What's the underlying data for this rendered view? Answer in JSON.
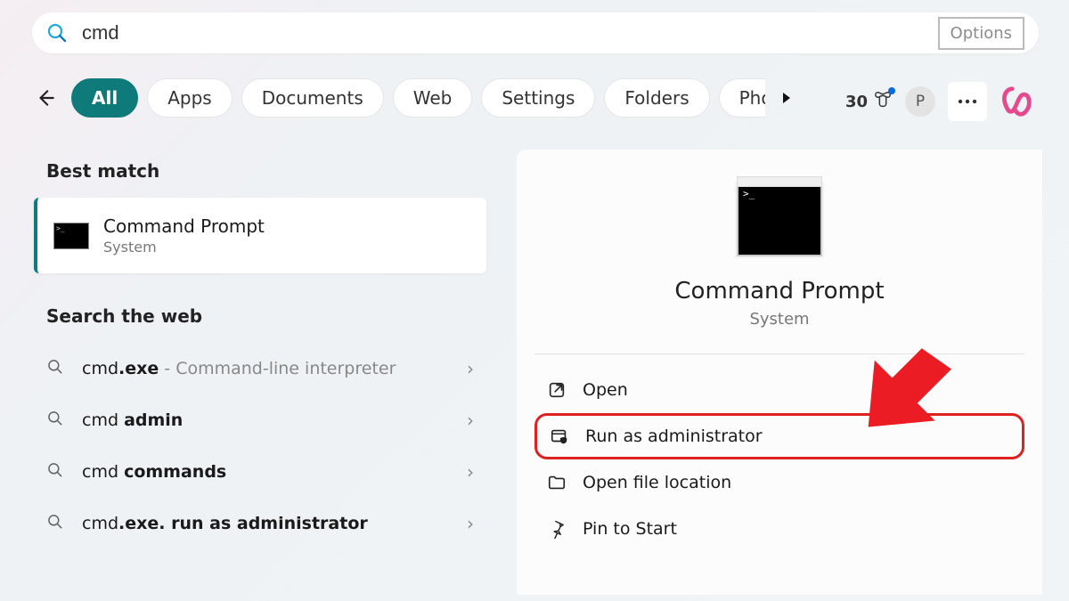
{
  "search": {
    "query": "cmd",
    "options_label": "Options"
  },
  "filters": {
    "items": [
      "All",
      "Apps",
      "Documents",
      "Web",
      "Settings",
      "Folders",
      "Pho"
    ],
    "active_index": 0
  },
  "header": {
    "points": "30",
    "avatar_initial": "P"
  },
  "left": {
    "best_match_heading": "Best match",
    "best_match": {
      "title": "Command Prompt",
      "subtitle": "System"
    },
    "web_heading": "Search the web",
    "web_items": [
      {
        "prefix": "cmd",
        "bold": ".exe",
        "suffix": " - Command-line interpreter",
        "suffix_light": true
      },
      {
        "prefix": "cmd ",
        "bold": "admin",
        "suffix": ""
      },
      {
        "prefix": "cmd ",
        "bold": "commands",
        "suffix": ""
      },
      {
        "prefix": "cmd",
        "bold": ".exe. run as administrator",
        "suffix": ""
      }
    ]
  },
  "panel": {
    "title": "Command Prompt",
    "subtitle": "System",
    "actions": [
      {
        "icon": "open-external",
        "label": "Open"
      },
      {
        "icon": "shield-window",
        "label": "Run as administrator",
        "highlight": true
      },
      {
        "icon": "folder",
        "label": "Open file location"
      },
      {
        "icon": "pin",
        "label": "Pin to Start"
      }
    ]
  }
}
